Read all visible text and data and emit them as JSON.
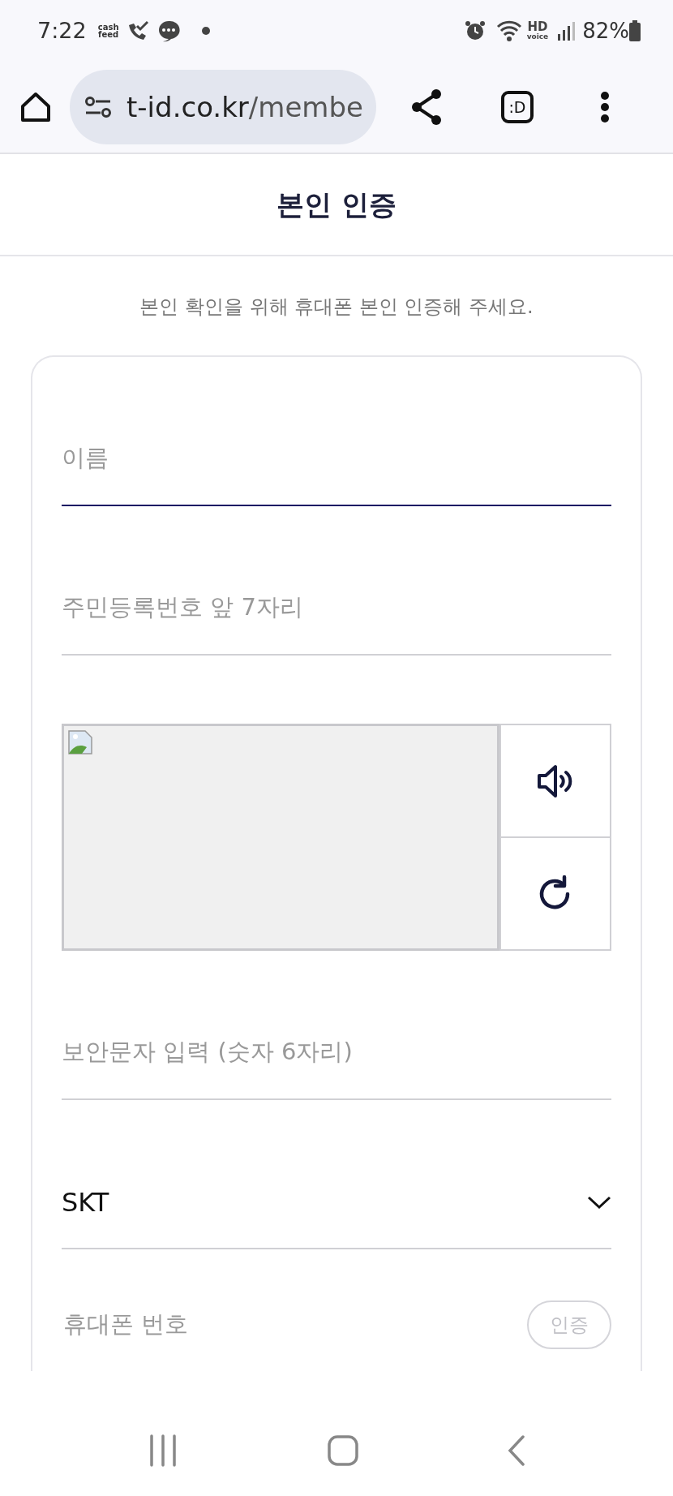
{
  "status_bar": {
    "time": "7:22",
    "notification_label": "cash feed",
    "hd_label": "HD",
    "voice_label": "voice",
    "battery": "82%"
  },
  "browser": {
    "url_host": "t-id.co.kr",
    "url_path": "/membe",
    "tab_label": ":D"
  },
  "header": {
    "title": "본인 인증"
  },
  "intro": "본인 확인을 위해 휴대폰 본인 인증해 주세요.",
  "form": {
    "fields": [
      {
        "kind": "text",
        "placeholder": "이름",
        "focused": true
      },
      {
        "kind": "text",
        "placeholder": "주민등록번호 앞 7자리",
        "focused": false
      },
      {
        "kind": "captcha"
      },
      {
        "kind": "text",
        "placeholder": "보안문자 입력 (숫자 6자리)",
        "focused": false
      },
      {
        "kind": "select",
        "value": "SKT",
        "focused": false
      },
      {
        "kind": "phone",
        "placeholder": "휴대폰 번호",
        "button": "인증",
        "button_disabled": true,
        "focused": false
      }
    ]
  }
}
